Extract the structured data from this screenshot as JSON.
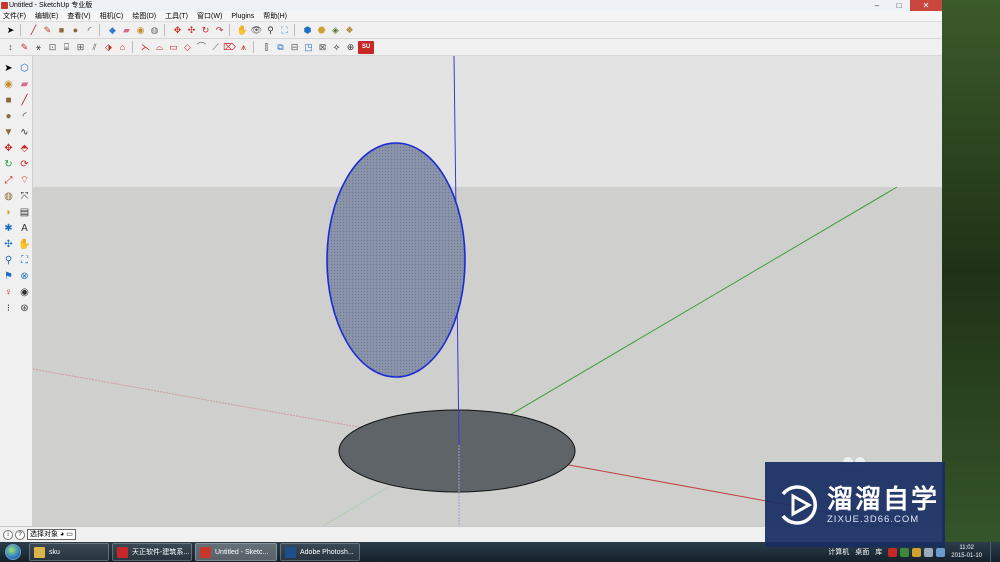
{
  "window": {
    "title": "Untitled - SketchUp 专业版",
    "buttons": [
      "–",
      "□",
      "✕"
    ]
  },
  "menu": [
    "文件(F)",
    "编辑(E)",
    "查看(V)",
    "相机(C)",
    "绘图(D)",
    "工具(T)",
    "窗口(W)",
    "Plugins",
    "帮助(H)"
  ],
  "toolbar1": [
    "select-icon",
    "line-icon",
    "pencil-icon",
    "rectangle-icon",
    "circle-icon",
    "arc-icon",
    "push-pull-icon",
    "eraser-icon",
    "paint-bucket-icon",
    "tape-measure-icon",
    "orbit-icon",
    "pan-icon",
    "zoom-icon",
    "zoom-extents-icon",
    "iso-view-icon",
    "top-view-icon",
    "front-view-icon",
    "warehouse-icon",
    "components-icon"
  ],
  "toolbar2_su_label": "SU\n2GO",
  "left_tools": [
    "select-icon",
    "make-component-icon",
    "paint-bucket-icon",
    "eraser-icon",
    "rectangle-icon",
    "line-icon",
    "circle-icon",
    "arc-icon",
    "polygon-icon",
    "freehand-icon",
    "move-icon",
    "push-pull-icon",
    "rotate-icon",
    "follow-me-icon",
    "scale-icon",
    "offset-icon",
    "tape-measure-icon",
    "dimension-icon",
    "protractor-icon",
    "text-icon",
    "axes-icon",
    "3d-text-icon",
    "orbit-icon",
    "pan-icon",
    "zoom-icon",
    "zoom-window-icon",
    "previous-view-icon",
    "zoom-extents-icon",
    "position-camera-icon",
    "look-around-icon",
    "walk-icon",
    "section-plane-icon"
  ],
  "status": {
    "hint": "选择对象",
    "buttons": [
      "i",
      "?"
    ]
  },
  "taskbar": {
    "tasks": [
      {
        "label": "sku",
        "color": "#d9b54a"
      },
      {
        "label": "天正软件-建筑系...",
        "color": "#c62828"
      },
      {
        "label": "Untitled - Sketc...",
        "color": "#c8352a"
      },
      {
        "label": "Adobe Photosh...",
        "color": "#1e4e8c"
      }
    ],
    "tray_items": [
      "计算机",
      "桌面",
      "库"
    ],
    "time": "11:02",
    "date": "2015-01-10"
  },
  "watermark": {
    "title": "溜溜自学",
    "url": "ZIXUE.3D66.COM"
  },
  "colors": {
    "sky": "#e3e3e3",
    "ground": "#cfcfcd",
    "selection": "#1b2bd6",
    "face_fill": "#8d97ab",
    "disk_fill": "#5e6468",
    "axis_red": "#c55a5a",
    "axis_green": "#3aa03a",
    "axis_blue": "#3a3ad8",
    "watermark_bg": "#182d63"
  }
}
